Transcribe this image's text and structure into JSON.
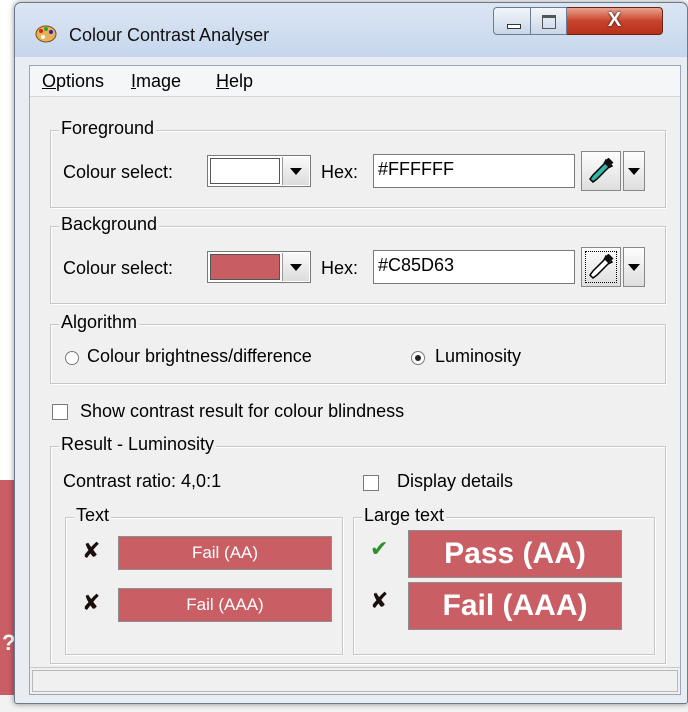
{
  "window": {
    "title": "Colour Contrast Analyser",
    "close_symbol": "X"
  },
  "menu": [
    "Options",
    "Image",
    "Help"
  ],
  "foreground": {
    "legend": "Foreground",
    "colour_select_label": "Colour select:",
    "swatch_color": "#FFFFFF",
    "hex_label": "Hex:",
    "hex_value": "#FFFFFF"
  },
  "background": {
    "legend": "Background",
    "colour_select_label": "Colour select:",
    "swatch_color": "#C85D63",
    "hex_label": "Hex:",
    "hex_value": "#C85D63"
  },
  "algorithm": {
    "legend": "Algorithm",
    "options": [
      {
        "label": "Colour brightness/difference",
        "selected": false
      },
      {
        "label": "Luminosity",
        "selected": true
      }
    ]
  },
  "colour_blindness_label": "Show contrast result for colour blindness",
  "result": {
    "legend": "Result - Luminosity",
    "contrast_ratio": "Contrast ratio: 4,0:1",
    "display_details_label": "Display details",
    "text": {
      "legend": "Text",
      "rows": [
        {
          "label": "Fail (AA)",
          "status": "fail"
        },
        {
          "label": "Fail (AAA)",
          "status": "fail"
        }
      ]
    },
    "large_text": {
      "legend": "Large text",
      "rows": [
        {
          "label": "Pass (AA)",
          "status": "pass"
        },
        {
          "label": "Fail (AAA)",
          "status": "fail"
        }
      ]
    }
  },
  "colors": {
    "result_fill": "#C95E64",
    "pass_mark": "#2F8F2A",
    "fail_mark": "#1B0F0C"
  },
  "icons": [
    "palette-icon",
    "eyedropper-icon",
    "check-icon",
    "cross-icon"
  ]
}
